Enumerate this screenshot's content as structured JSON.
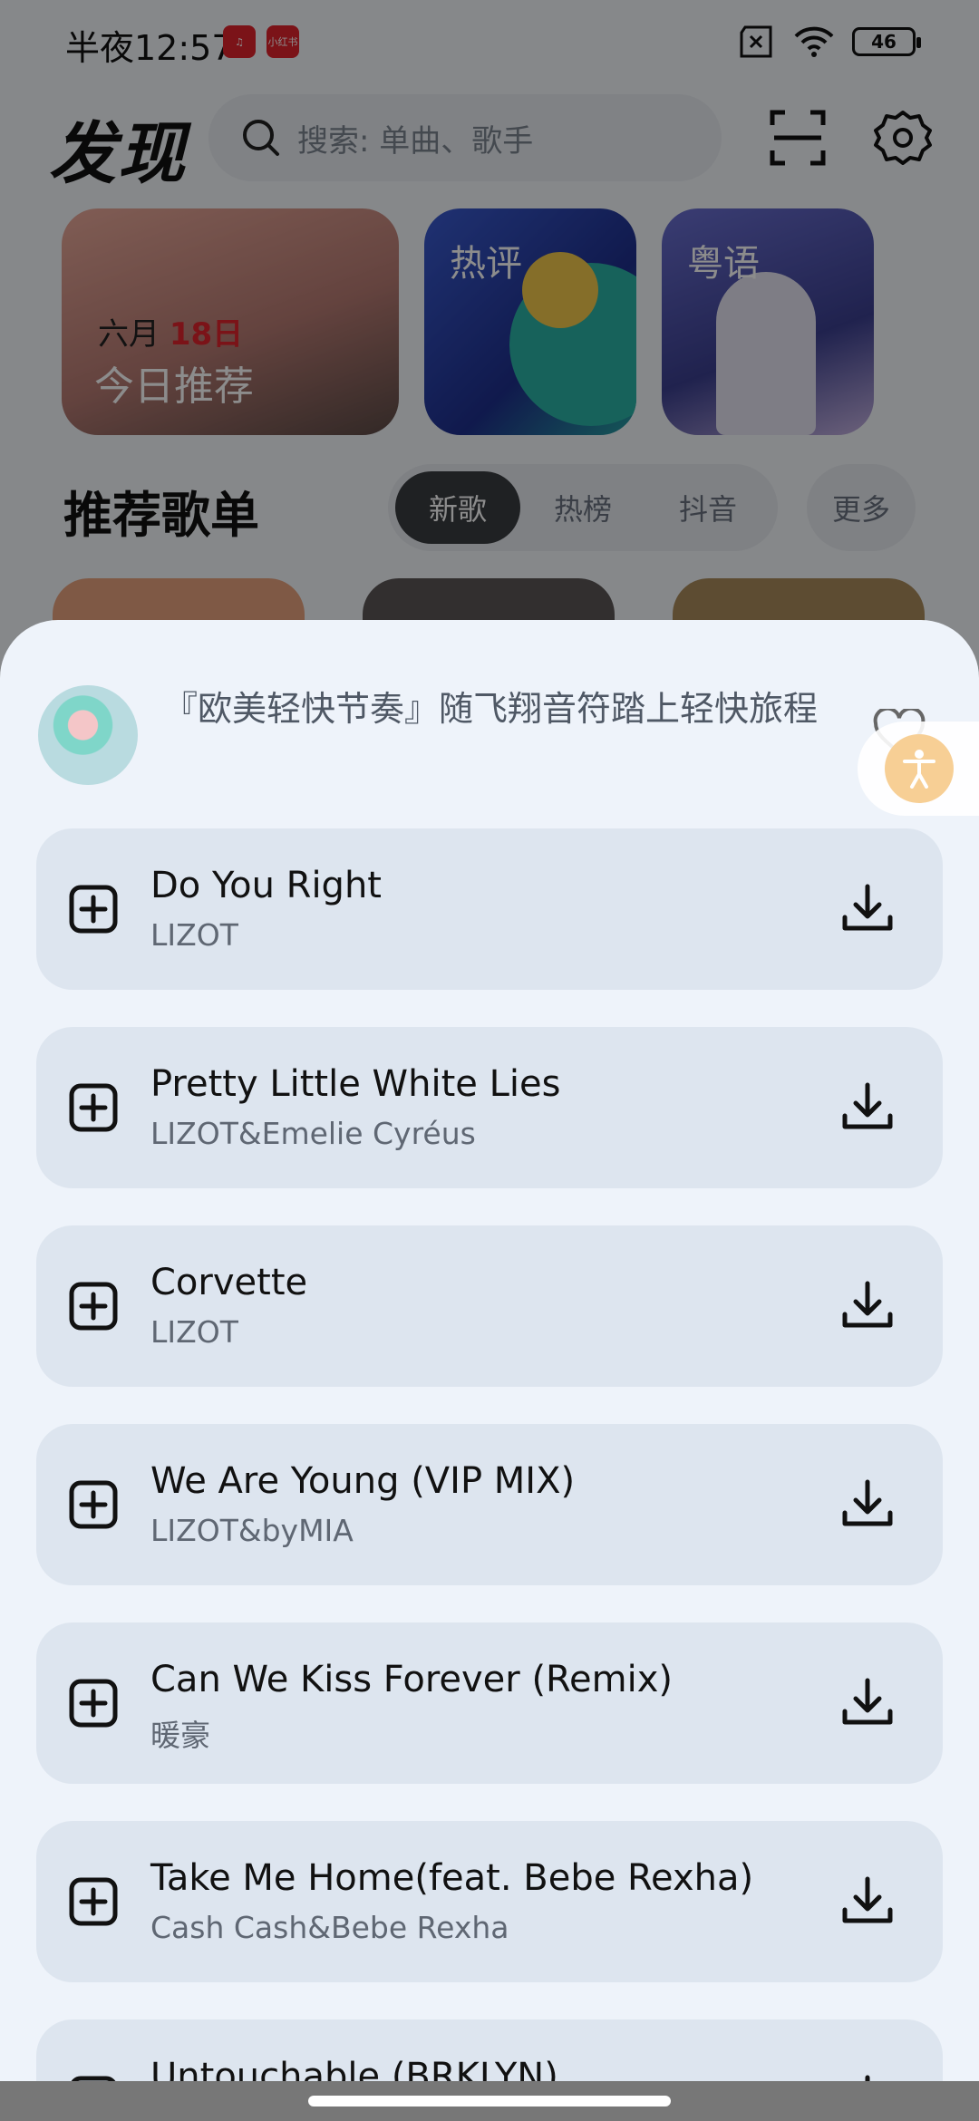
{
  "status_bar": {
    "time": "半夜12:57",
    "app1": "♫",
    "app2": "小红书",
    "battery": "46"
  },
  "header": {
    "title": "发现",
    "search_placeholder": "搜索: 单曲、歌手"
  },
  "banners": [
    {
      "date_month": "六月",
      "date_day": "18日",
      "title": "今日推荐"
    },
    {
      "tag": "热评"
    },
    {
      "tag": "粤语"
    }
  ],
  "recommend": {
    "title": "推荐歌单",
    "tabs": [
      "新歌",
      "热榜",
      "抖音"
    ],
    "more": "更多"
  },
  "sheet": {
    "playlist_title": "『欧美轻快节奏』随飞翔音符踏上轻快旅程",
    "songs": [
      {
        "name": "Do You Right",
        "artist": "LIZOT"
      },
      {
        "name": "Pretty Little White Lies",
        "artist": "LIZOT&Emelie Cyréus"
      },
      {
        "name": "Corvette",
        "artist": "LIZOT"
      },
      {
        "name": "We Are Young (VIP MIX)",
        "artist": "LIZOT&byMIA"
      },
      {
        "name": "Can We Kiss Forever (Remix)",
        "artist": "暖豪"
      },
      {
        "name": "Take Me Home(feat. Bebe Rexha)",
        "artist": "Cash Cash&Bebe Rexha"
      },
      {
        "name": "Untouchable (BRKLYN)",
        "artist": ""
      }
    ]
  }
}
